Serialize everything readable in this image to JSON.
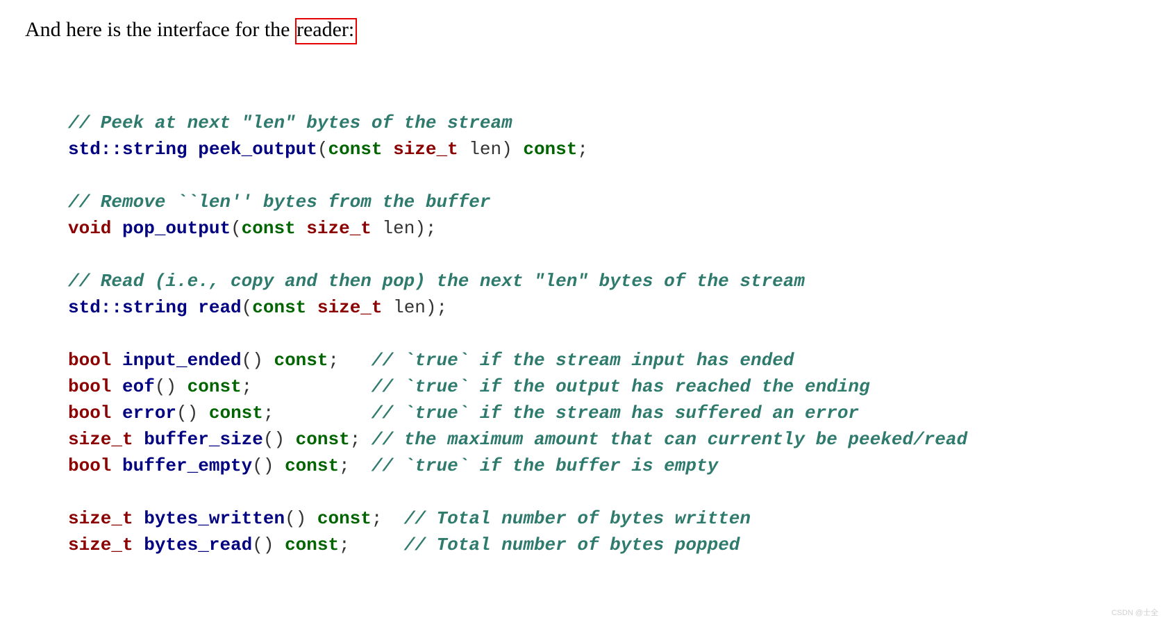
{
  "intro": {
    "prefix": "And here is the interface for the",
    "highlighted": "reader:"
  },
  "code": {
    "comment_peek": "// Peek at next \"len\" bytes of the stream",
    "peek_ns": "std::string",
    "peek_fn": " peek_output",
    "peek_open": "(",
    "peek_kw": "const",
    "peek_type": " size_t",
    "peek_args_close": " len) ",
    "peek_const": "const",
    "peek_semi": ";",
    "comment_pop": "// Remove ``len'' bytes from the buffer",
    "pop_type": "void",
    "pop_fn": " pop_output",
    "pop_open": "(",
    "pop_kw": "const",
    "pop_type2": " size_t",
    "pop_close": " len);",
    "comment_read": "// Read (i.e., copy and then pop) the next \"len\" bytes of the stream",
    "read_ns": "std::string",
    "read_fn": " read",
    "read_open": "(",
    "read_kw": "const",
    "read_type": " size_t",
    "read_close": " len);",
    "bool1": "bool",
    "fn1": " input_ended",
    "paren1": "() ",
    "const1": "const",
    "semi1": ";   ",
    "cmt1": "// `true` if the stream input has ended",
    "bool2": "bool",
    "fn2": " eof",
    "paren2": "() ",
    "const2": "const",
    "semi2": ";           ",
    "cmt2": "// `true` if the output has reached the ending",
    "bool3": "bool",
    "fn3": " error",
    "paren3": "() ",
    "const3": "const",
    "semi3": ";         ",
    "cmt3": "// `true` if the stream has suffered an error",
    "sizet1": "size_t",
    "fn4": " buffer_size",
    "paren4": "() ",
    "const4": "const",
    "semi4": "; ",
    "cmt4": "// the maximum amount that can currently be peeked/read",
    "bool5": "bool",
    "fn5": " buffer_empty",
    "paren5": "() ",
    "const5": "const",
    "semi5": ";  ",
    "cmt5": "// `true` if the buffer is empty",
    "sizet2": "size_t",
    "fn6": " bytes_written",
    "paren6": "() ",
    "const6": "const",
    "semi6": ";  ",
    "cmt6": "// Total number of bytes written",
    "sizet3": "size_t",
    "fn7": " bytes_read",
    "paren7": "() ",
    "const7": "const",
    "semi7": ";     ",
    "cmt7": "// Total number of bytes popped"
  },
  "watermark": "CSDN @士全"
}
